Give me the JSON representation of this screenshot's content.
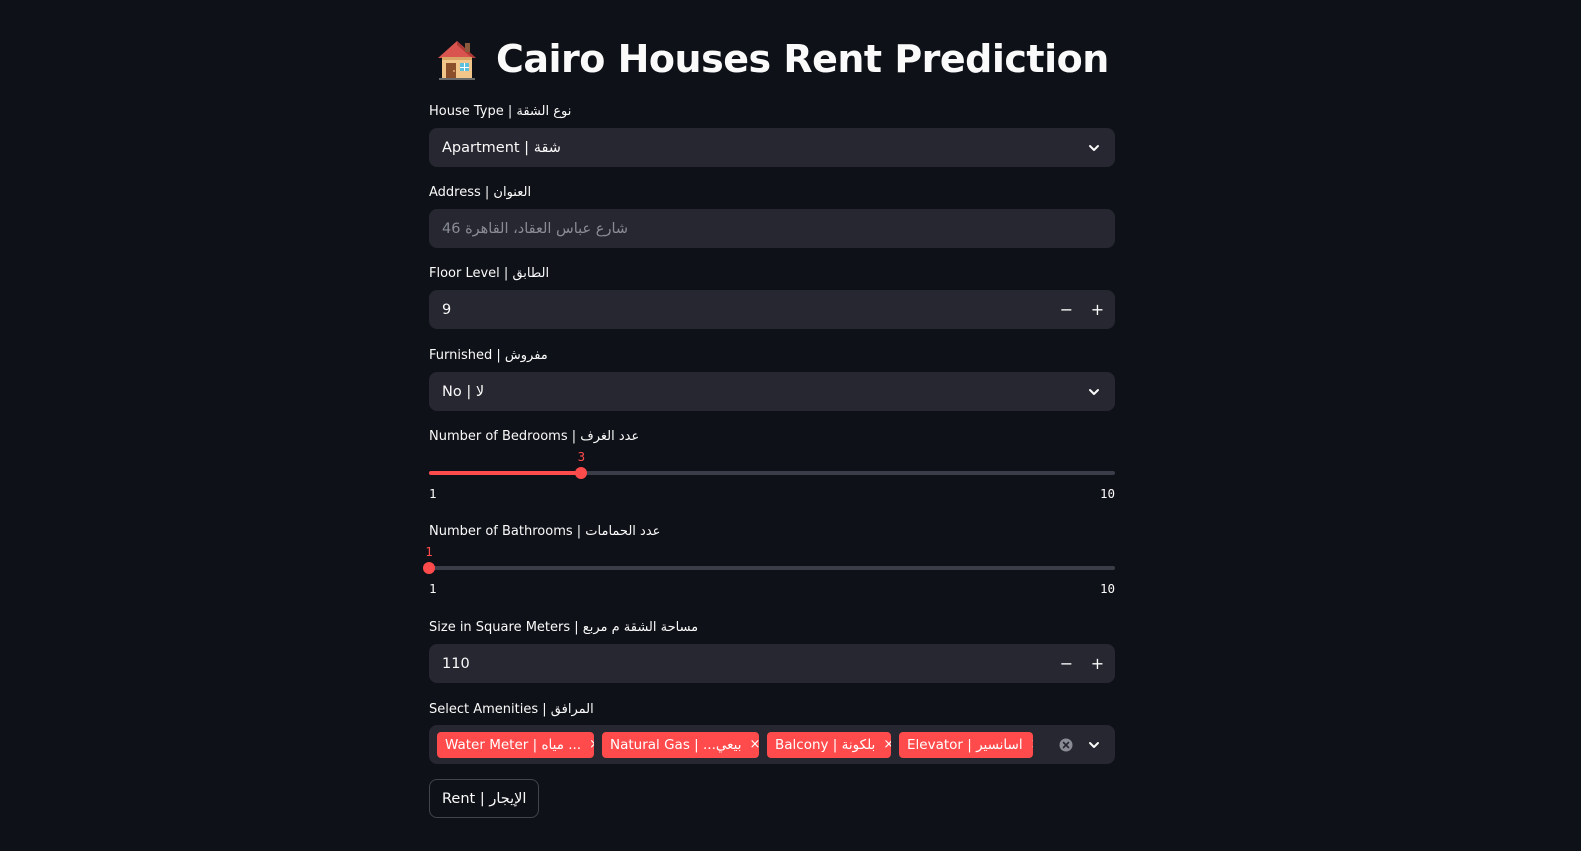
{
  "title": "Cairo Houses Rent Prediction",
  "icons": {
    "title": "house-icon",
    "dropdown": "chevron-down-icon",
    "stepper_minus": "minus-icon",
    "stepper_plus": "plus-icon",
    "chip_remove": "close-icon",
    "clear_all": "clear-circle-icon"
  },
  "colors": {
    "background": "#0e1117",
    "field": "#262730",
    "accent": "#ff4b4b",
    "text": "#fafafa"
  },
  "house_type": {
    "label": "House Type | نوع الشقة",
    "value": "Apartment | شقة"
  },
  "address": {
    "label": "Address | العنوان",
    "placeholder": "46 شارع عباس العقاد، القاهرة"
  },
  "floor": {
    "label": "Floor Level | الطابق",
    "value": "9",
    "minus": "−",
    "plus": "+"
  },
  "furnished": {
    "label": "Furnished | مفروش",
    "value": "No | لا"
  },
  "bedrooms": {
    "label": "Number of Bedrooms | عدد الغرف",
    "value": 3,
    "value_text": "3",
    "min": 1,
    "max": 10,
    "min_text": "1",
    "max_text": "10"
  },
  "bathrooms": {
    "label": "Number of Bathrooms | عدد الحمامات",
    "value": 1,
    "value_text": "1",
    "min": 1,
    "max": 10,
    "min_text": "1",
    "max_text": "10"
  },
  "size": {
    "label": "Size in Square Meters | مساحة الشقة م مربع",
    "value": "110",
    "minus": "−",
    "plus": "+"
  },
  "amenities": {
    "label": "Select Amenities | المرافق",
    "chips": [
      {
        "text": "Water Meter | عداد مياه",
        "display": "Water Meter | مياه ..."
      },
      {
        "text": "Natural Gas | غاز طبيعي",
        "display": "Natural Gas | ...بيعي"
      },
      {
        "text": "Balcony | بلكونة",
        "display": "Balcony | بلكونة"
      },
      {
        "text": "Elevator | أسانسير",
        "display": "Elevator | اسانسير"
      }
    ],
    "remove_symbol": "×"
  },
  "submit": {
    "label": "Rent | الإيجار"
  }
}
